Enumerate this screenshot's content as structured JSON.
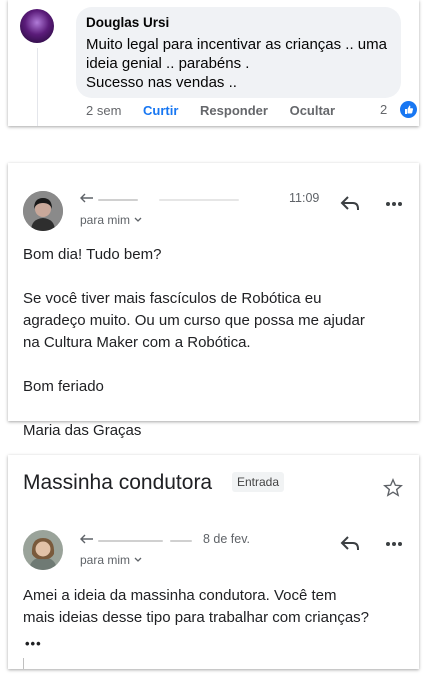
{
  "facebook_comment": {
    "author": "Douglas Ursi",
    "text_lines": [
      "Muito legal para incentivar as crianças .. uma",
      "ideia genial .. parabéns .",
      "Sucesso nas vendas .."
    ],
    "time": "2 sem",
    "actions": {
      "like": "Curtir",
      "reply": "Responder",
      "hide": "Ocultar"
    },
    "like_count": "2"
  },
  "email1": {
    "time": "11:09",
    "recipient": "para mim",
    "body_lines": [
      "Bom dia! Tudo bem?",
      "",
      "Se você tiver mais fascículos de Robótica eu",
      "agradeço muito. Ou um curso que possa me ajudar",
      "na Cultura Maker com a Robótica.",
      "",
      "Bom feriado",
      "",
      "Maria das Graças"
    ]
  },
  "email2": {
    "subject": "Massinha condutora",
    "label": "Entrada",
    "date": "8 de fev.",
    "recipient": "para mim",
    "body_lines": [
      "Amei a ideia da massinha condutora. Você tem",
      "mais ideias desse tipo para trabalhar com crianças?"
    ],
    "more": "•••"
  },
  "icons": [
    "reply-icon",
    "more-vert-icon",
    "star-icon",
    "chevron-down-icon",
    "thumbs-up-icon"
  ],
  "colors": {
    "facebook_blue": "#1877f2",
    "bubble_gray": "#f0f2f5",
    "text_gray": "#5f6368"
  }
}
